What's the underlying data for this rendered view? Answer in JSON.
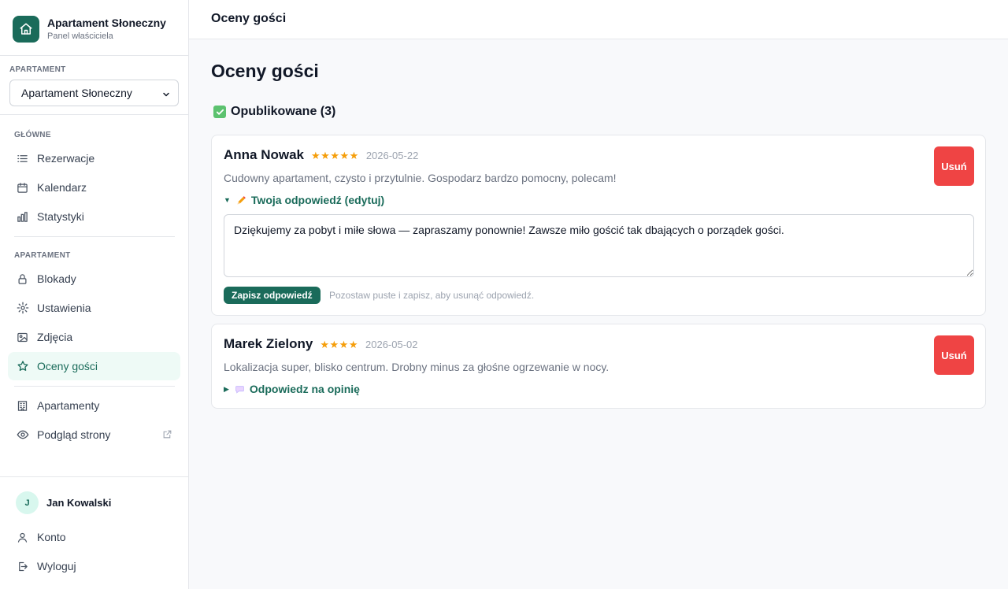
{
  "brand": {
    "title": "Apartament Słoneczny",
    "subtitle": "Panel właściciela",
    "icon": "home-icon"
  },
  "apartment_picker": {
    "label": "APARTAMENT",
    "selected": "Apartament Słoneczny"
  },
  "nav": {
    "main_label": "GŁÓWNE",
    "main_items": [
      {
        "label": "Rezerwacje",
        "icon": "list-icon"
      },
      {
        "label": "Kalendarz",
        "icon": "calendar-icon"
      },
      {
        "label": "Statystyki",
        "icon": "bar-chart-icon"
      }
    ],
    "apartment_label": "APARTAMENT",
    "apartment_items": [
      {
        "label": "Blokady",
        "icon": "lock-icon"
      },
      {
        "label": "Ustawienia",
        "icon": "gear-icon"
      },
      {
        "label": "Zdjęcia",
        "icon": "image-icon"
      },
      {
        "label": "Oceny gości",
        "icon": "star-icon",
        "active": true
      }
    ],
    "other_items": [
      {
        "label": "Apartamenty",
        "icon": "building-icon"
      },
      {
        "label": "Podgląd strony",
        "icon": "eye-icon"
      }
    ]
  },
  "user": {
    "initial": "J",
    "name": "Jan Kowalski"
  },
  "account_items": [
    {
      "label": "Konto",
      "icon": "user-icon"
    },
    {
      "label": "Wyloguj",
      "icon": "logout-icon"
    }
  ],
  "topbar": {
    "title": "Oceny gości"
  },
  "page": {
    "title": "Oceny gości",
    "section_heading": "Opublikowane (3)"
  },
  "reviews": [
    {
      "name": "Anna Nowak",
      "stars": "★★★★★",
      "rating": 5,
      "date": "2026-05-22",
      "text": "Cudowny apartament, czysto i przytulnie. Gospodarz bardzo pomocny, polecam!",
      "reply_toggle": "Twoja odpowiedź (edytuj)",
      "reply_text": "Dziękujemy za pobyt i miłe słowa — zapraszamy ponownie! Zawsze miło gościć tak dbających o porządek gości.",
      "save_label": "Zapisz odpowiedź",
      "save_hint": "Pozostaw puste i zapisz, aby usunąć odpowiedź.",
      "delete_label": "Usuń"
    },
    {
      "name": "Marek Zielony",
      "stars": "★★★★",
      "rating": 4,
      "date": "2026-05-02",
      "text": "Lokalizacja super, blisko centrum. Drobny minus za głośne ogrzewanie w nocy.",
      "reply_toggle": "Odpowiedz na opinię",
      "delete_label": "Usuń"
    }
  ],
  "colors": {
    "accent": "#1a6b5a",
    "danger": "#ef4444",
    "star": "#f59e0b"
  }
}
